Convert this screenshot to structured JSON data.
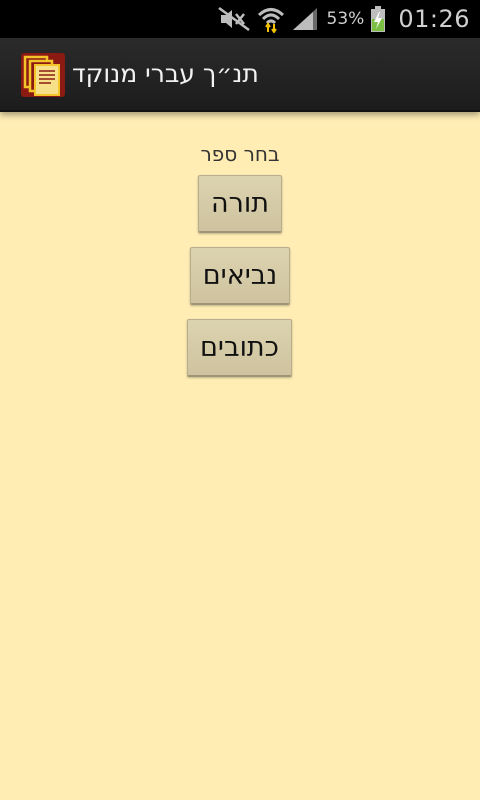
{
  "status_bar": {
    "battery_percent": "53%",
    "time": "01:26",
    "icons": [
      "mute-icon",
      "wifi-icon",
      "signal-icon",
      "battery-charging-icon"
    ]
  },
  "action_bar": {
    "app_icon": "book-pages-icon",
    "title": "תנ״ך עברי מנוקד"
  },
  "main": {
    "prompt": "בחר ספר",
    "buttons": [
      {
        "label": "תורה"
      },
      {
        "label": "נביאים"
      },
      {
        "label": "כתובים"
      }
    ]
  },
  "colors": {
    "background": "#FFEDB4",
    "button": "#D6CBA8",
    "action_bar": "#222222",
    "status_bar": "#000000"
  }
}
